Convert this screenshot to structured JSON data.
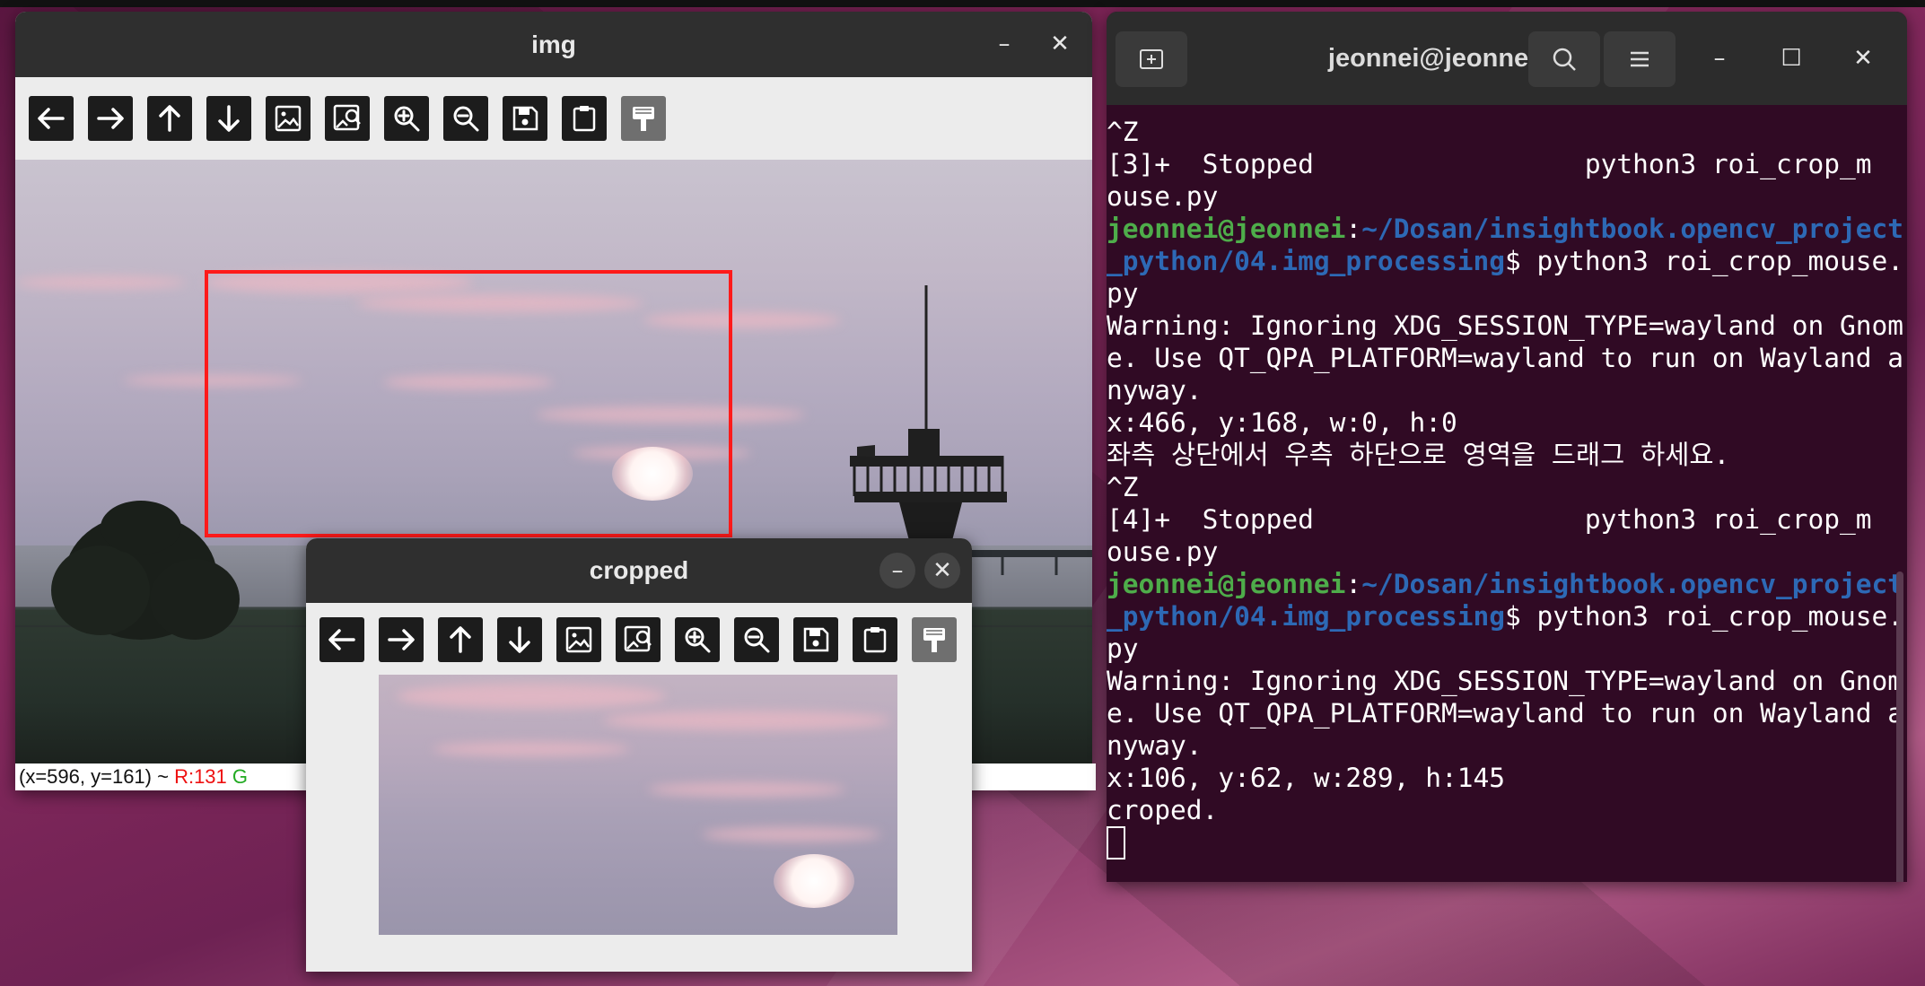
{
  "img_window": {
    "title": "img",
    "minimize": "–",
    "close": "✕",
    "status": {
      "coords": "(x=596, y=161) ~ ",
      "r": "R:131",
      "g_partial": "G"
    }
  },
  "crop_window": {
    "title": "cropped",
    "minimize": "–",
    "close": "✕"
  },
  "toolbar_icons": [
    "arrow-left",
    "arrow-right",
    "arrow-up",
    "arrow-down",
    "image",
    "image-zoom",
    "zoom-in",
    "zoom-out",
    "save",
    "clipboard",
    "paint"
  ],
  "terminal": {
    "title": "jeonnei@jeonnei: ~/...",
    "minimize": "–",
    "maximize": "☐",
    "close": "✕",
    "prompt_user": "jeonnei@jeonnei",
    "prompt_path": "~/Dosan/insightbook.opencv_project_python/04.img_processing",
    "lines": {
      "l1": "^Z",
      "l2": "[3]+  Stopped                 python3 roi_crop_m",
      "l3": "ouse.py",
      "cmd1": "$ python3 roi_crop_mouse.py",
      "warn1": "Warning: Ignoring XDG_SESSION_TYPE=wayland on Gnome. Use QT_QPA_PLATFORM=wayland to run on Wayland anyway.",
      "l5": "x:466, y:168, w:0, h:0",
      "l6": "좌측 상단에서 우측 하단으로 영역을 드래그 하세요.",
      "l7": "^Z",
      "l8": "[4]+  Stopped                 python3 roi_crop_m",
      "l9": "ouse.py",
      "cmd2": "$ python3 roi_crop_mouse.py",
      "warn2": "Warning: Ignoring XDG_SESSION_TYPE=wayland on Gnome. Use QT_QPA_PLATFORM=wayland to run on Wayland anyway.",
      "l10": "x:106, y:62, w:289, h:145",
      "l11": "croped."
    }
  },
  "colors": {
    "roi_rect": "#ff1a1a",
    "terminal_bg": "#300a24",
    "prompt_user": "#4ead4a",
    "prompt_path": "#2d69b5"
  }
}
